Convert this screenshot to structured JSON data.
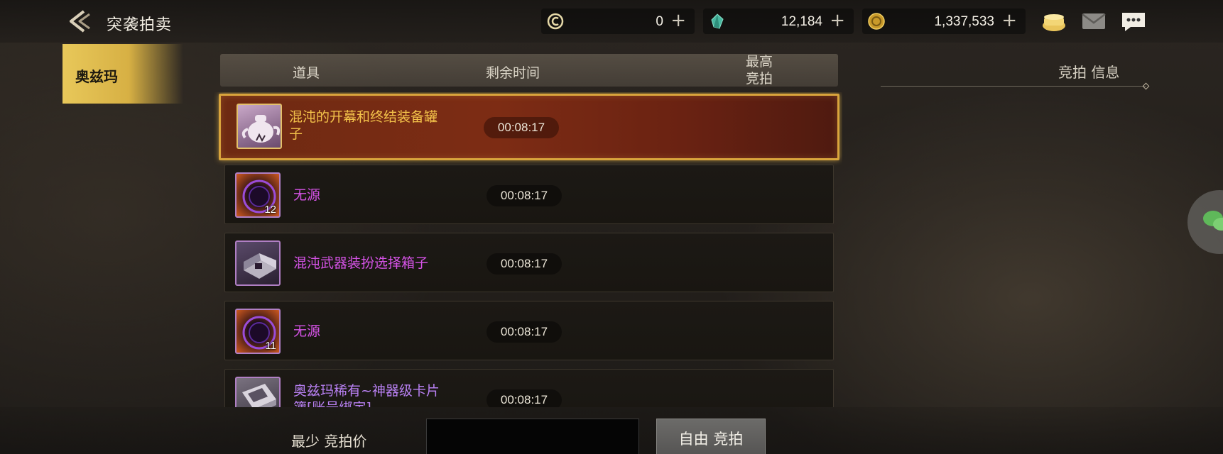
{
  "header": {
    "title": "突袭拍卖",
    "currencies": [
      {
        "icon": "c-coin-icon",
        "value": "0"
      },
      {
        "icon": "crystal-icon",
        "value": "12,184"
      },
      {
        "icon": "gold-coin-icon",
        "value": "1,337,533"
      }
    ],
    "plus": "+"
  },
  "tab": {
    "label": "奥兹玛"
  },
  "columns": {
    "item": "道具",
    "time": "剩余时间",
    "bid_line1": "最高",
    "bid_line2": "竞拍"
  },
  "info_label": "竞拍 信息",
  "items": [
    {
      "name": "混沌的开幕和终结装备罐子",
      "time": "00:08:17",
      "count": "",
      "icon": "teapot-icon",
      "name_color": "#f3c24a"
    },
    {
      "name": "无源",
      "time": "00:08:17",
      "count": "12",
      "icon": "orb-icon",
      "name_color": "#d553e6"
    },
    {
      "name": "混沌武器装扮选择箱子",
      "time": "00:08:17",
      "count": "",
      "icon": "weapon-box-icon",
      "name_color": "#d553e6"
    },
    {
      "name": "无源",
      "time": "00:08:17",
      "count": "11",
      "icon": "orb-icon",
      "name_color": "#d553e6"
    },
    {
      "name": "奥兹玛稀有~神器级卡片簿[账号绑定]",
      "time": "00:08:17",
      "count": "",
      "icon": "card-book-icon",
      "name_color": "#b880f2"
    }
  ],
  "bottom": {
    "min_bid_label": "最少 竞拍价",
    "min_bid_value": "",
    "free_bid_label": "自由 竞拍"
  }
}
